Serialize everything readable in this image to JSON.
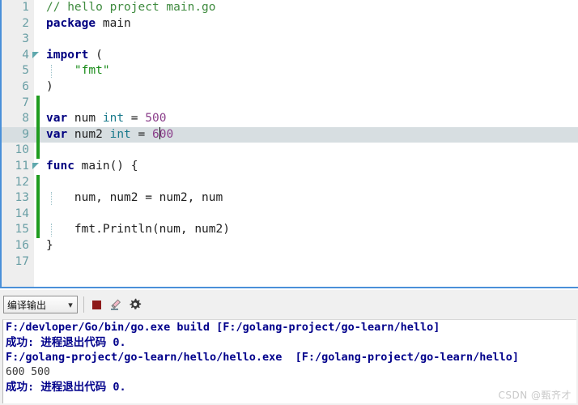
{
  "editor": {
    "name": "go-code-editor",
    "caret_line": 9,
    "highlighted_line": 9,
    "lines": [
      {
        "n": 1,
        "fold": false,
        "change": false,
        "guide": false,
        "tokens": [
          {
            "t": "// hello project main.go",
            "c": "cm"
          }
        ]
      },
      {
        "n": 2,
        "fold": false,
        "change": false,
        "guide": false,
        "tokens": [
          {
            "t": "package",
            "c": "k"
          },
          {
            "t": " main",
            "c": "id"
          }
        ]
      },
      {
        "n": 3,
        "fold": false,
        "change": false,
        "guide": false,
        "tokens": []
      },
      {
        "n": 4,
        "fold": true,
        "change": false,
        "guide": false,
        "tokens": [
          {
            "t": "import",
            "c": "k"
          },
          {
            "t": " (",
            "c": "pn"
          }
        ]
      },
      {
        "n": 5,
        "fold": false,
        "change": false,
        "guide": true,
        "tokens": [
          {
            "t": "    ",
            "c": "pn"
          },
          {
            "t": "\"fmt\"",
            "c": "st"
          }
        ]
      },
      {
        "n": 6,
        "fold": false,
        "change": false,
        "guide": false,
        "tokens": [
          {
            "t": ")",
            "c": "pn"
          }
        ]
      },
      {
        "n": 7,
        "fold": false,
        "change": true,
        "guide": false,
        "tokens": []
      },
      {
        "n": 8,
        "fold": false,
        "change": true,
        "guide": false,
        "tokens": [
          {
            "t": "var",
            "c": "k"
          },
          {
            "t": " num ",
            "c": "id"
          },
          {
            "t": "int",
            "c": "ty"
          },
          {
            "t": " = ",
            "c": "pn"
          },
          {
            "t": "500",
            "c": "nu"
          }
        ]
      },
      {
        "n": 9,
        "fold": false,
        "change": true,
        "guide": false,
        "tokens": [
          {
            "t": "var",
            "c": "k"
          },
          {
            "t": " num2 ",
            "c": "id"
          },
          {
            "t": "int",
            "c": "ty"
          },
          {
            "t": " = ",
            "c": "pn"
          },
          {
            "t": "6",
            "c": "nu"
          },
          {
            "t": "|caret|",
            "c": "caret"
          },
          {
            "t": "00",
            "c": "nu"
          }
        ]
      },
      {
        "n": 10,
        "fold": false,
        "change": true,
        "guide": false,
        "tokens": []
      },
      {
        "n": 11,
        "fold": true,
        "change": false,
        "guide": false,
        "tokens": [
          {
            "t": "func",
            "c": "k"
          },
          {
            "t": " main",
            "c": "fn"
          },
          {
            "t": "() {",
            "c": "pn"
          }
        ]
      },
      {
        "n": 12,
        "fold": false,
        "change": true,
        "guide": false,
        "tokens": []
      },
      {
        "n": 13,
        "fold": false,
        "change": true,
        "guide": true,
        "tokens": [
          {
            "t": "    num, num2 = num2, num",
            "c": "id"
          }
        ]
      },
      {
        "n": 14,
        "fold": false,
        "change": true,
        "guide": false,
        "tokens": []
      },
      {
        "n": 15,
        "fold": false,
        "change": true,
        "guide": true,
        "tokens": [
          {
            "t": "    fmt.Println(num, num2)",
            "c": "id"
          }
        ]
      },
      {
        "n": 16,
        "fold": false,
        "change": false,
        "guide": false,
        "tokens": [
          {
            "t": "}",
            "c": "pn"
          }
        ]
      },
      {
        "n": 17,
        "fold": false,
        "change": false,
        "guide": false,
        "tokens": []
      }
    ]
  },
  "console": {
    "selector": {
      "value": "编译输出",
      "options": [
        "编译输出"
      ],
      "chevron": "chevron-down-icon"
    },
    "buttons": [
      {
        "name": "stop-button",
        "icon": "stop-square-icon"
      },
      {
        "name": "clear-button",
        "icon": "eraser-icon"
      },
      {
        "name": "settings-button",
        "icon": "gear-icon"
      }
    ],
    "output_lines": [
      {
        "text": "F:/devloper/Go/bin/go.exe build [F:/golang-project/go-learn/hello]",
        "style": "status"
      },
      {
        "text": "成功: 进程退出代码 0.",
        "style": "status"
      },
      {
        "text": "F:/golang-project/go-learn/hello/hello.exe  [F:/golang-project/go-learn/hello]",
        "style": "status"
      },
      {
        "text": "600 500",
        "style": "plain"
      },
      {
        "text": "成功: 进程退出代码 0.",
        "style": "status"
      }
    ]
  },
  "watermark": {
    "text": "CSDN @甄齐才"
  },
  "colors": {
    "accent_border": "#4a90d9",
    "gutter_bg": "#eeeeee",
    "line_number": "#6a9fa5",
    "change_bar": "#1f9c1f",
    "current_line_hl": "#d7dee1",
    "keyword": "#000080",
    "comment": "#3f8b3f",
    "string": "#1a8c1a",
    "number": "#8b3f8b",
    "type": "#1a7a8c",
    "console_status": "#00008b",
    "stop_icon": "#8e1b1b"
  }
}
